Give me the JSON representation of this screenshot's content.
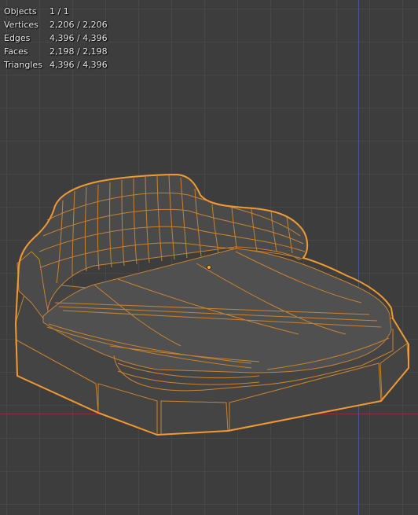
{
  "viewport": {
    "background": "#3d3d3d",
    "grid_color": "#484848",
    "x_axis_color": "#8d2f38",
    "y_axis_color": "#3f5b92"
  },
  "stats": {
    "objects": {
      "label": "Objects",
      "value": "1 / 1"
    },
    "vertices": {
      "label": "Vertices",
      "value": "2,206 / 2,206"
    },
    "edges": {
      "label": "Edges",
      "value": "4,396 / 4,396"
    },
    "faces": {
      "label": "Faces",
      "value": "2,198 / 2,198"
    },
    "triangles": {
      "label": "Triangles",
      "value": "4,396 / 4,396"
    }
  },
  "selection": {
    "outline_color": "#f19a31",
    "wire_color": "#c9822d",
    "origin_color": "#f5a623"
  }
}
